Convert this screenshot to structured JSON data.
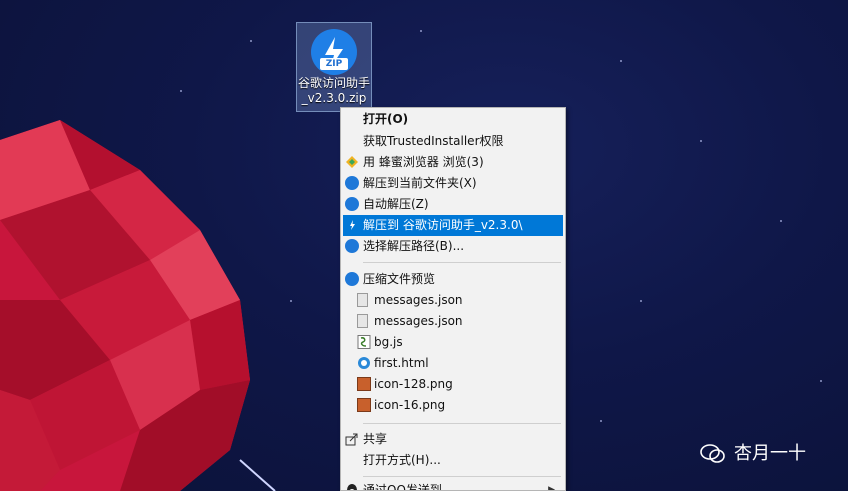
{
  "file": {
    "label_line1": "谷歌访问助手",
    "label_line2": "_v2.3.0.zip",
    "badge": "ZIP"
  },
  "menu": {
    "items": [
      {
        "label": "打开(O)"
      },
      {
        "label": "获取TrustedInstaller权限"
      },
      {
        "label": "用 蜂蜜浏览器 浏览(3)"
      },
      {
        "label": "解压到当前文件夹(X)"
      },
      {
        "label": "自动解压(Z)"
      },
      {
        "label": "解压到 谷歌访问助手_v2.3.0\\"
      },
      {
        "label": "选择解压路径(B)..."
      },
      {
        "label": "压缩文件预览"
      },
      {
        "label": "messages.json"
      },
      {
        "label": "messages.json"
      },
      {
        "label": "bg.js"
      },
      {
        "label": "first.html"
      },
      {
        "label": "icon-128.png"
      },
      {
        "label": "icon-16.png"
      },
      {
        "label": "共享"
      },
      {
        "label": "打开方式(H)..."
      },
      {
        "label": "通过QQ发送到"
      }
    ],
    "submenu_arrow": "▶",
    "highlight_color": "#0078d7"
  },
  "watermark": {
    "text": "杏月一十"
  }
}
